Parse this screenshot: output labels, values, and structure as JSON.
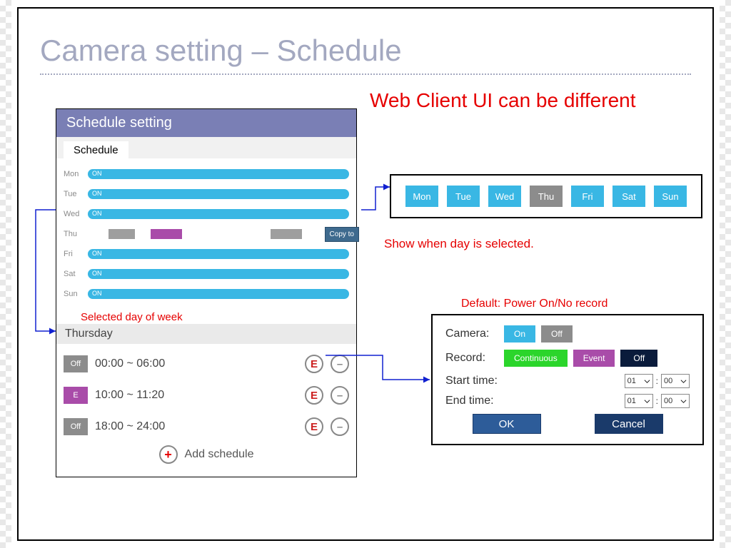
{
  "title": "Camera setting – Schedule",
  "note_main": "Web Client UI can be different",
  "panel": {
    "header": "Schedule setting",
    "tab": "Schedule"
  },
  "timeline": {
    "days": [
      "Mon",
      "Tue",
      "Wed",
      "Thu",
      "Fri",
      "Sat",
      "Sun"
    ],
    "on_label": "ON"
  },
  "copy_button": "Copy to",
  "selected_label": "Selected day of week",
  "selected_day": "Thursday",
  "rows": [
    {
      "chip": "Off",
      "chip_class": "off",
      "time": "00:00 ~ 06:00"
    },
    {
      "chip": "E",
      "chip_class": "e",
      "time": "10:00 ~ 11:20"
    },
    {
      "chip": "Off",
      "chip_class": "off",
      "time": "18:00 ~ 24:00"
    }
  ],
  "edit_label": "E",
  "minus_label": "–",
  "add_label": "Add schedule",
  "plus_label": "+",
  "days_box": [
    "Mon",
    "Tue",
    "Wed",
    "Thu",
    "Fri",
    "Sat",
    "Sun"
  ],
  "days_box_selected": "Thu",
  "show_note": "Show when day is selected.",
  "default_note": "Default: Power On/No record",
  "detail": {
    "camera_label": "Camera:",
    "on": "On",
    "off": "Off",
    "record_label": "Record:",
    "continuous": "Continuous",
    "event": "Event",
    "roff": "Off",
    "start": "Start time:",
    "end": "End time:",
    "h1": "01",
    "m1": "00",
    "h2": "01",
    "m2": "00",
    "ok": "OK",
    "cancel": "Cancel"
  }
}
